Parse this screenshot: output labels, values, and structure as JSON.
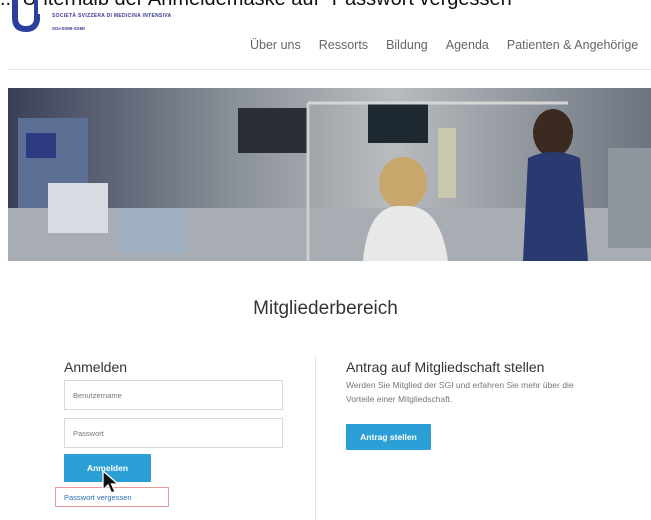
{
  "caption": "... Unterhalb der Anmeldemaske auf \"Passwort vergessen\"",
  "org": {
    "name_line1": "SOCIETÀ SVIZZERA DI MEDICINA INTENSIVA",
    "name_line2": "SGI-SSMI-SSMI"
  },
  "nav": [
    "Über uns",
    "Ressorts",
    "Bildung",
    "Agenda",
    "Patienten & Angehörige"
  ],
  "page_title": "Mitgliederbereich",
  "login": {
    "heading": "Anmelden",
    "username_placeholder": "Benutzername",
    "password_placeholder": "Passwort",
    "submit_label": "Anmelden",
    "forgot_label": "Passwort vergessen"
  },
  "membership": {
    "heading": "Antrag auf Mitgliedschaft stellen",
    "text": "Werden Sie Mitglied der SGI und erfahren Sie mehr über die Vorteile einer Mitgliedschaft.",
    "button_label": "Antrag stellen"
  },
  "colors": {
    "accent": "#2b9fd6",
    "logo": "#3a3a9a",
    "highlight": "#e89a9a"
  }
}
